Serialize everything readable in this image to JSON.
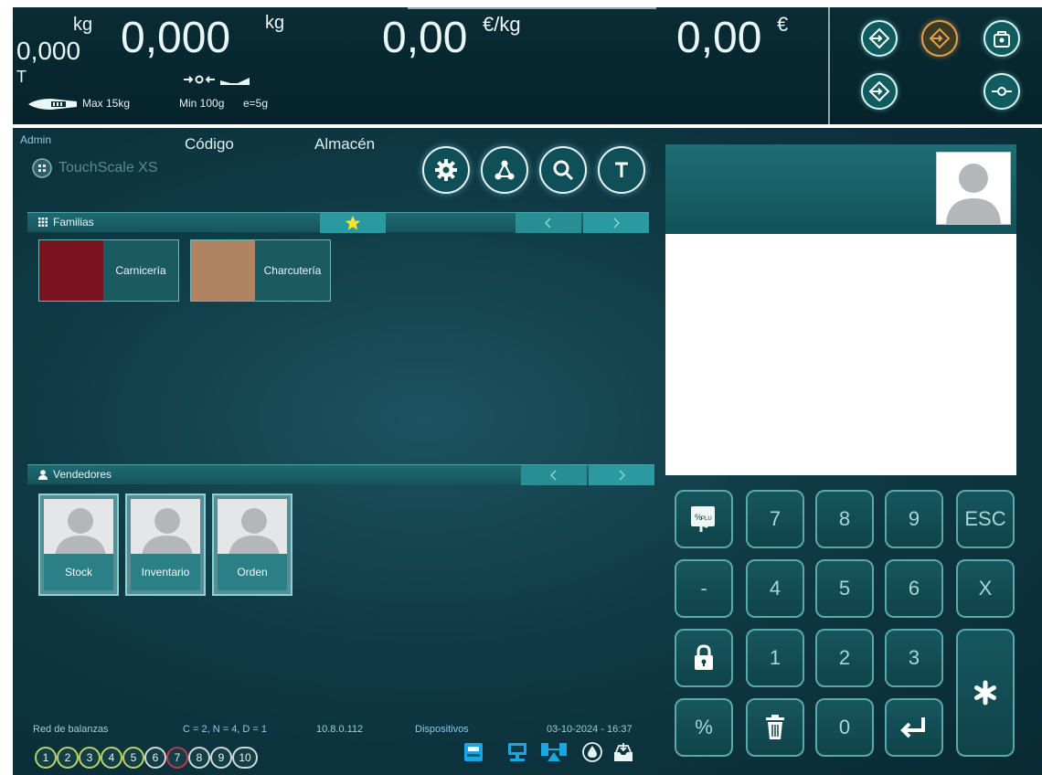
{
  "header": {
    "weight_small": "0,000",
    "weight_small_unit": "kg",
    "tare_indicator": "T",
    "weight_main": "0,000",
    "weight_unit": "kg",
    "price_per_kg": "0,00",
    "price_per_kg_unit": "€/kg",
    "total_price": "0,00",
    "total_unit": "€",
    "max_capacity": "Max 15kg",
    "min_capacity": "Min 100g",
    "division": "e=5g"
  },
  "main": {
    "user": "Admin",
    "logo_text": "TouchScale XS",
    "column_code": "Código",
    "column_store": "Almacén"
  },
  "families": {
    "title": "Familias",
    "items": [
      {
        "name": "Carnicería",
        "color": "#7a1320"
      },
      {
        "name": "Charcutería",
        "color": "#b08462"
      }
    ]
  },
  "sellers": {
    "title": "Vendedores",
    "items": [
      {
        "name": "Stock"
      },
      {
        "name": "Inventario"
      },
      {
        "name": "Orden"
      }
    ]
  },
  "keypad": {
    "keys": [
      "7",
      "8",
      "9",
      "ESC",
      "-",
      "4",
      "5",
      "6",
      "X",
      "1",
      "2",
      "3",
      "%",
      "0"
    ]
  },
  "footer": {
    "network_label": "Red de balanzas",
    "network_stats": "C = 2, N = 4, D = 1",
    "ip": "10.8.0.112",
    "devices_label": "Dispositivos",
    "datetime": "03-10-2024 - 16:37",
    "scales": [
      "1",
      "2",
      "3",
      "4",
      "5",
      "6",
      "7",
      "8",
      "9",
      "10"
    ]
  },
  "colors": {
    "accent_teal": "#2a9aa0",
    "scale_ring_green": "#b9d36a",
    "scale_ring_red": "#c0394a",
    "device_blue": "#1aa6e0",
    "star_yellow": "#ffe22a",
    "orange_button": "#e2a04a"
  }
}
